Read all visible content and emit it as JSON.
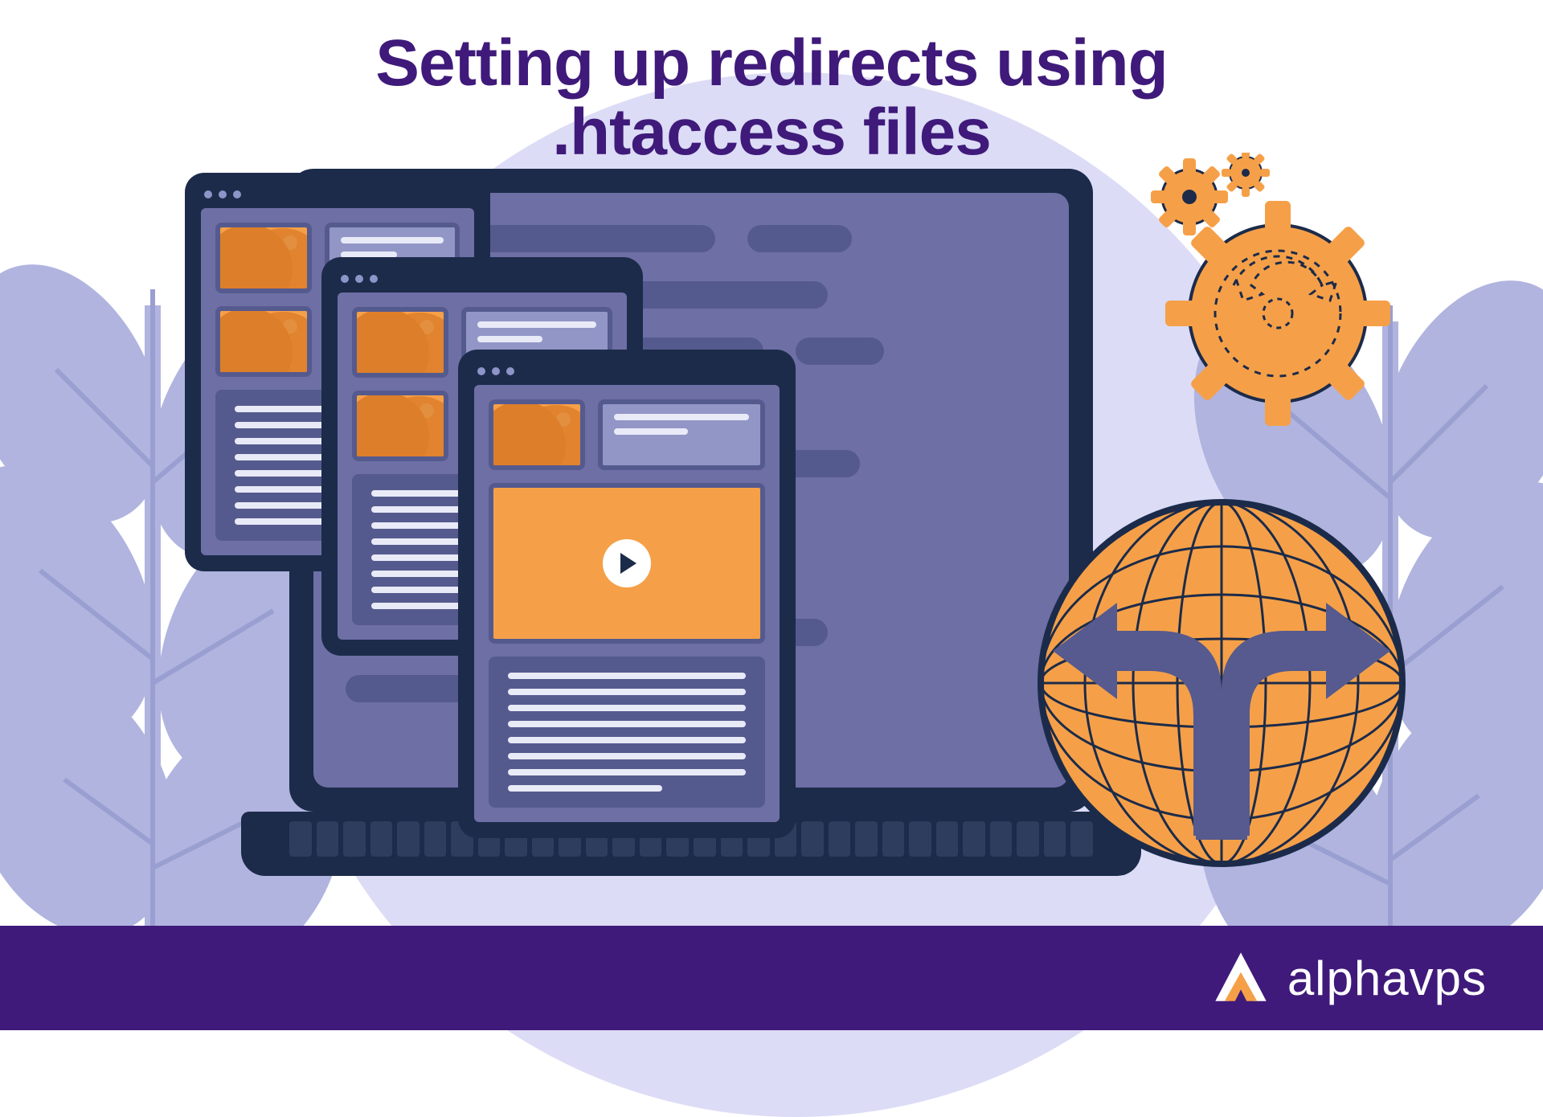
{
  "headline": {
    "line1": "Setting up redirects using",
    "line2": ".htaccess files"
  },
  "brand": {
    "name": "alphavps"
  },
  "colors": {
    "headline": "#3f1a7a",
    "footer": "#3f1a7a",
    "accent_orange": "#f5a048",
    "panel_dark": "#1c2b4a",
    "panel_mid": "#6d6fa5",
    "bg_circle": "#dcdcf6",
    "leaf": "#b0b4df"
  },
  "icons": {
    "gear": "gear-icon",
    "globe": "globe-redirect-icon",
    "play": "play-icon",
    "logo": "alphavps-logo-icon",
    "leaf": "leaf-icon",
    "window": "browser-window-icon"
  }
}
